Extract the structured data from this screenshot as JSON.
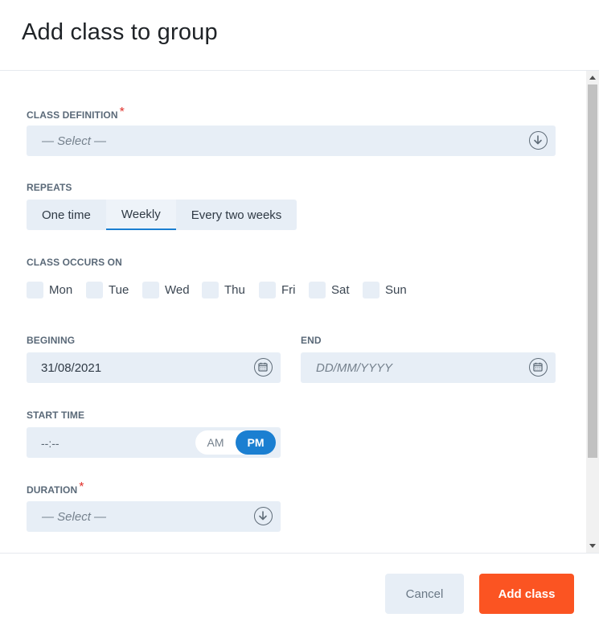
{
  "dialog": {
    "title": "Add class to group"
  },
  "class_definition": {
    "label": "CLASS DEFINITION",
    "required_mark": "*",
    "placeholder": "— Select —"
  },
  "repeats": {
    "label": "REPEATS",
    "options": [
      "One time",
      "Weekly",
      "Every two weeks"
    ],
    "selected": "Weekly"
  },
  "class_occurs_on": {
    "label": "CLASS OCCURS ON",
    "days": [
      "Mon",
      "Tue",
      "Wed",
      "Thu",
      "Fri",
      "Sat",
      "Sun"
    ]
  },
  "begining": {
    "label": "BEGINING",
    "value": "31/08/2021"
  },
  "end": {
    "label": "END",
    "placeholder": "DD/MM/YYYY"
  },
  "start_time": {
    "label": "START TIME",
    "value": "--:--",
    "am": "AM",
    "pm": "PM",
    "selected": "PM"
  },
  "duration": {
    "label": "DURATION",
    "required_mark": "*",
    "placeholder": "— Select —"
  },
  "footer": {
    "cancel_label": "Cancel",
    "add_label": "Add class"
  },
  "colors": {
    "accent": "#1b7fd1",
    "primary_button": "#fb5422",
    "field_bg": "#e7eef6",
    "required": "#e0302a"
  }
}
